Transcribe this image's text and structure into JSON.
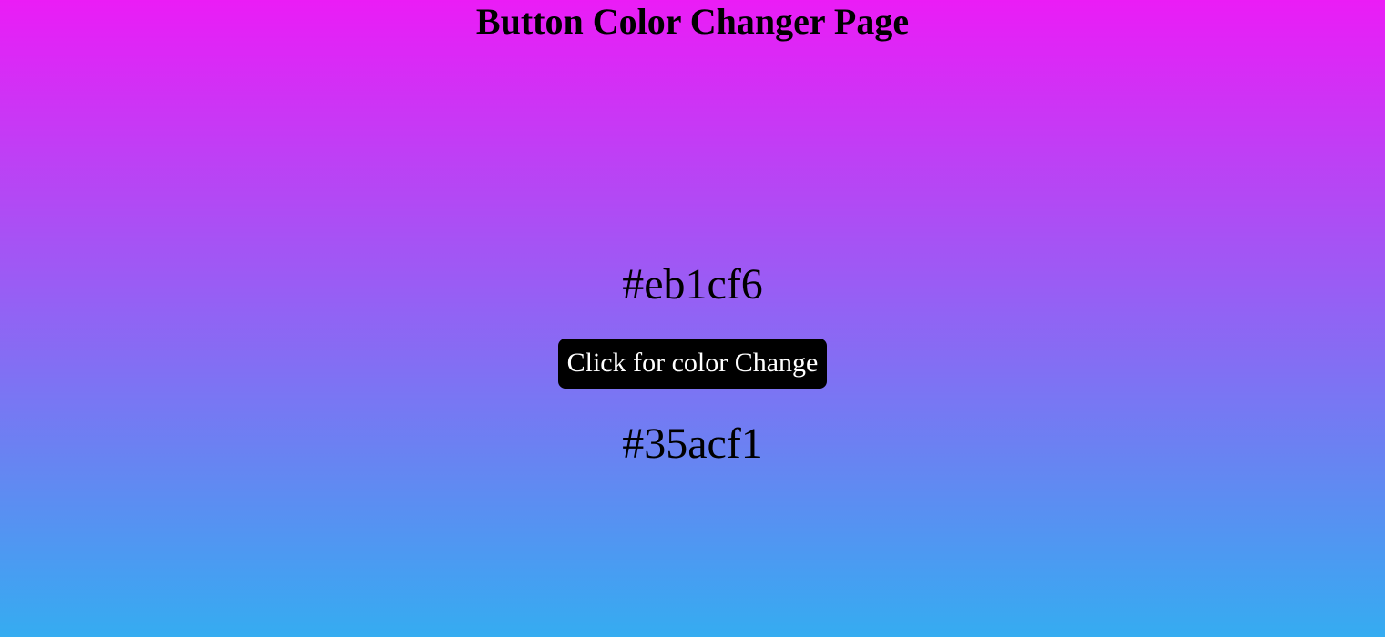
{
  "header": {
    "title": "Button Color Changer Page"
  },
  "main": {
    "top_color_code": "#eb1cf6",
    "button_label": "Click for color Change",
    "bottom_color_code": "#35acf1"
  },
  "colors": {
    "gradient_top": "#eb1cf6",
    "gradient_bottom": "#35acf1",
    "button_background": "#000000",
    "button_text": "#ffffff"
  }
}
